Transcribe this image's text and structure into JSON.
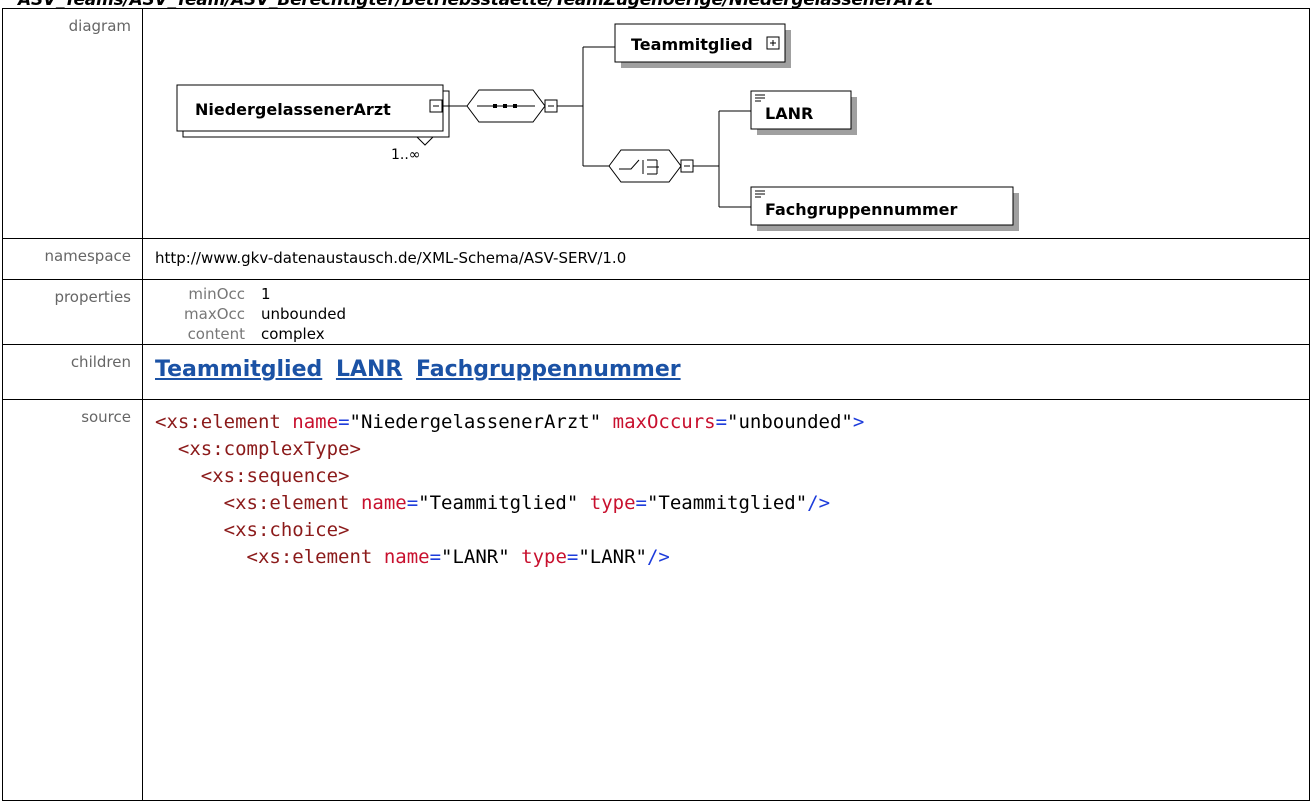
{
  "page_title": "ASV_Teams/ASV_Team/ASV_Berechtigter/Betriebsstaette/TeamZugehoerige/NiedergelassenerArzt",
  "labels": {
    "diagram": "diagram",
    "namespace": "namespace",
    "properties": "properties",
    "children": "children",
    "source": "source"
  },
  "diagram": {
    "root": "NiedergelassenerArzt",
    "root_occurrence": "1..∞",
    "child_teammitglied": "Teammitglied",
    "child_lanr": "LANR",
    "child_fachgruppe": "Fachgruppennummer"
  },
  "namespace": "http://www.gkv-datenaustausch.de/XML-Schema/ASV-SERV/1.0",
  "properties": [
    {
      "key": "minOcc",
      "value": "1"
    },
    {
      "key": "maxOcc",
      "value": "unbounded"
    },
    {
      "key": "content",
      "value": "complex"
    }
  ],
  "children": [
    "Teammitglied",
    "LANR",
    "Fachgruppennummer"
  ],
  "source": {
    "line1": {
      "tag": "<xs:element",
      "attr1": "name",
      "val1": "\"NiedergelassenerArzt\"",
      "attr2": "maxOccurs",
      "val2": "\"unbounded\"",
      "end": ">"
    },
    "line2": "<xs:complexType>",
    "line3": "<xs:sequence>",
    "line4": {
      "tag": "<xs:element",
      "attr1": "name",
      "val1": "\"Teammitglied\"",
      "attr2": "type",
      "val2": "\"Teammitglied\"",
      "end": "/>"
    },
    "line5": "<xs:choice>",
    "line6": {
      "tag": "<xs:element",
      "attr1": "name",
      "val1": "\"LANR\"",
      "attr2": "type",
      "val2": "\"LANR\"",
      "end": "/>"
    }
  },
  "colors": {
    "link": "#1b52a5",
    "tag": "#8b1a1a",
    "attr": "#c8102e",
    "punct": "#1d3cdb"
  }
}
